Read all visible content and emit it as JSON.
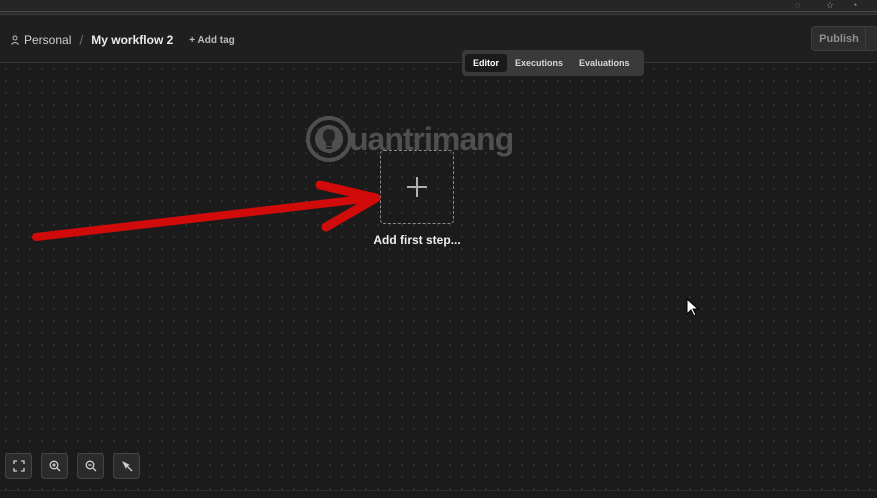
{
  "breadcrumb": {
    "project": "Personal",
    "separator": "/",
    "workflow_title": "My workflow 2",
    "add_tag": "+ Add tag"
  },
  "header": {
    "publish_label": "Publish"
  },
  "tabs": [
    {
      "label": "Editor",
      "active": true
    },
    {
      "label": "Executions",
      "active": false
    },
    {
      "label": "Evaluations",
      "active": false
    }
  ],
  "canvas": {
    "add_step_label": "Add first step..."
  },
  "watermark": {
    "text": "uantrimang"
  },
  "zoom_controls": [
    {
      "icon": "fit-view-icon"
    },
    {
      "icon": "zoom-in-icon"
    },
    {
      "icon": "zoom-out-icon"
    },
    {
      "icon": "tidy-up-icon"
    }
  ],
  "colors": {
    "canvas_bg": "#1b1b1b",
    "annotation_arrow": "#d10a0a",
    "active_tab_bg": "#1a1a1a"
  }
}
